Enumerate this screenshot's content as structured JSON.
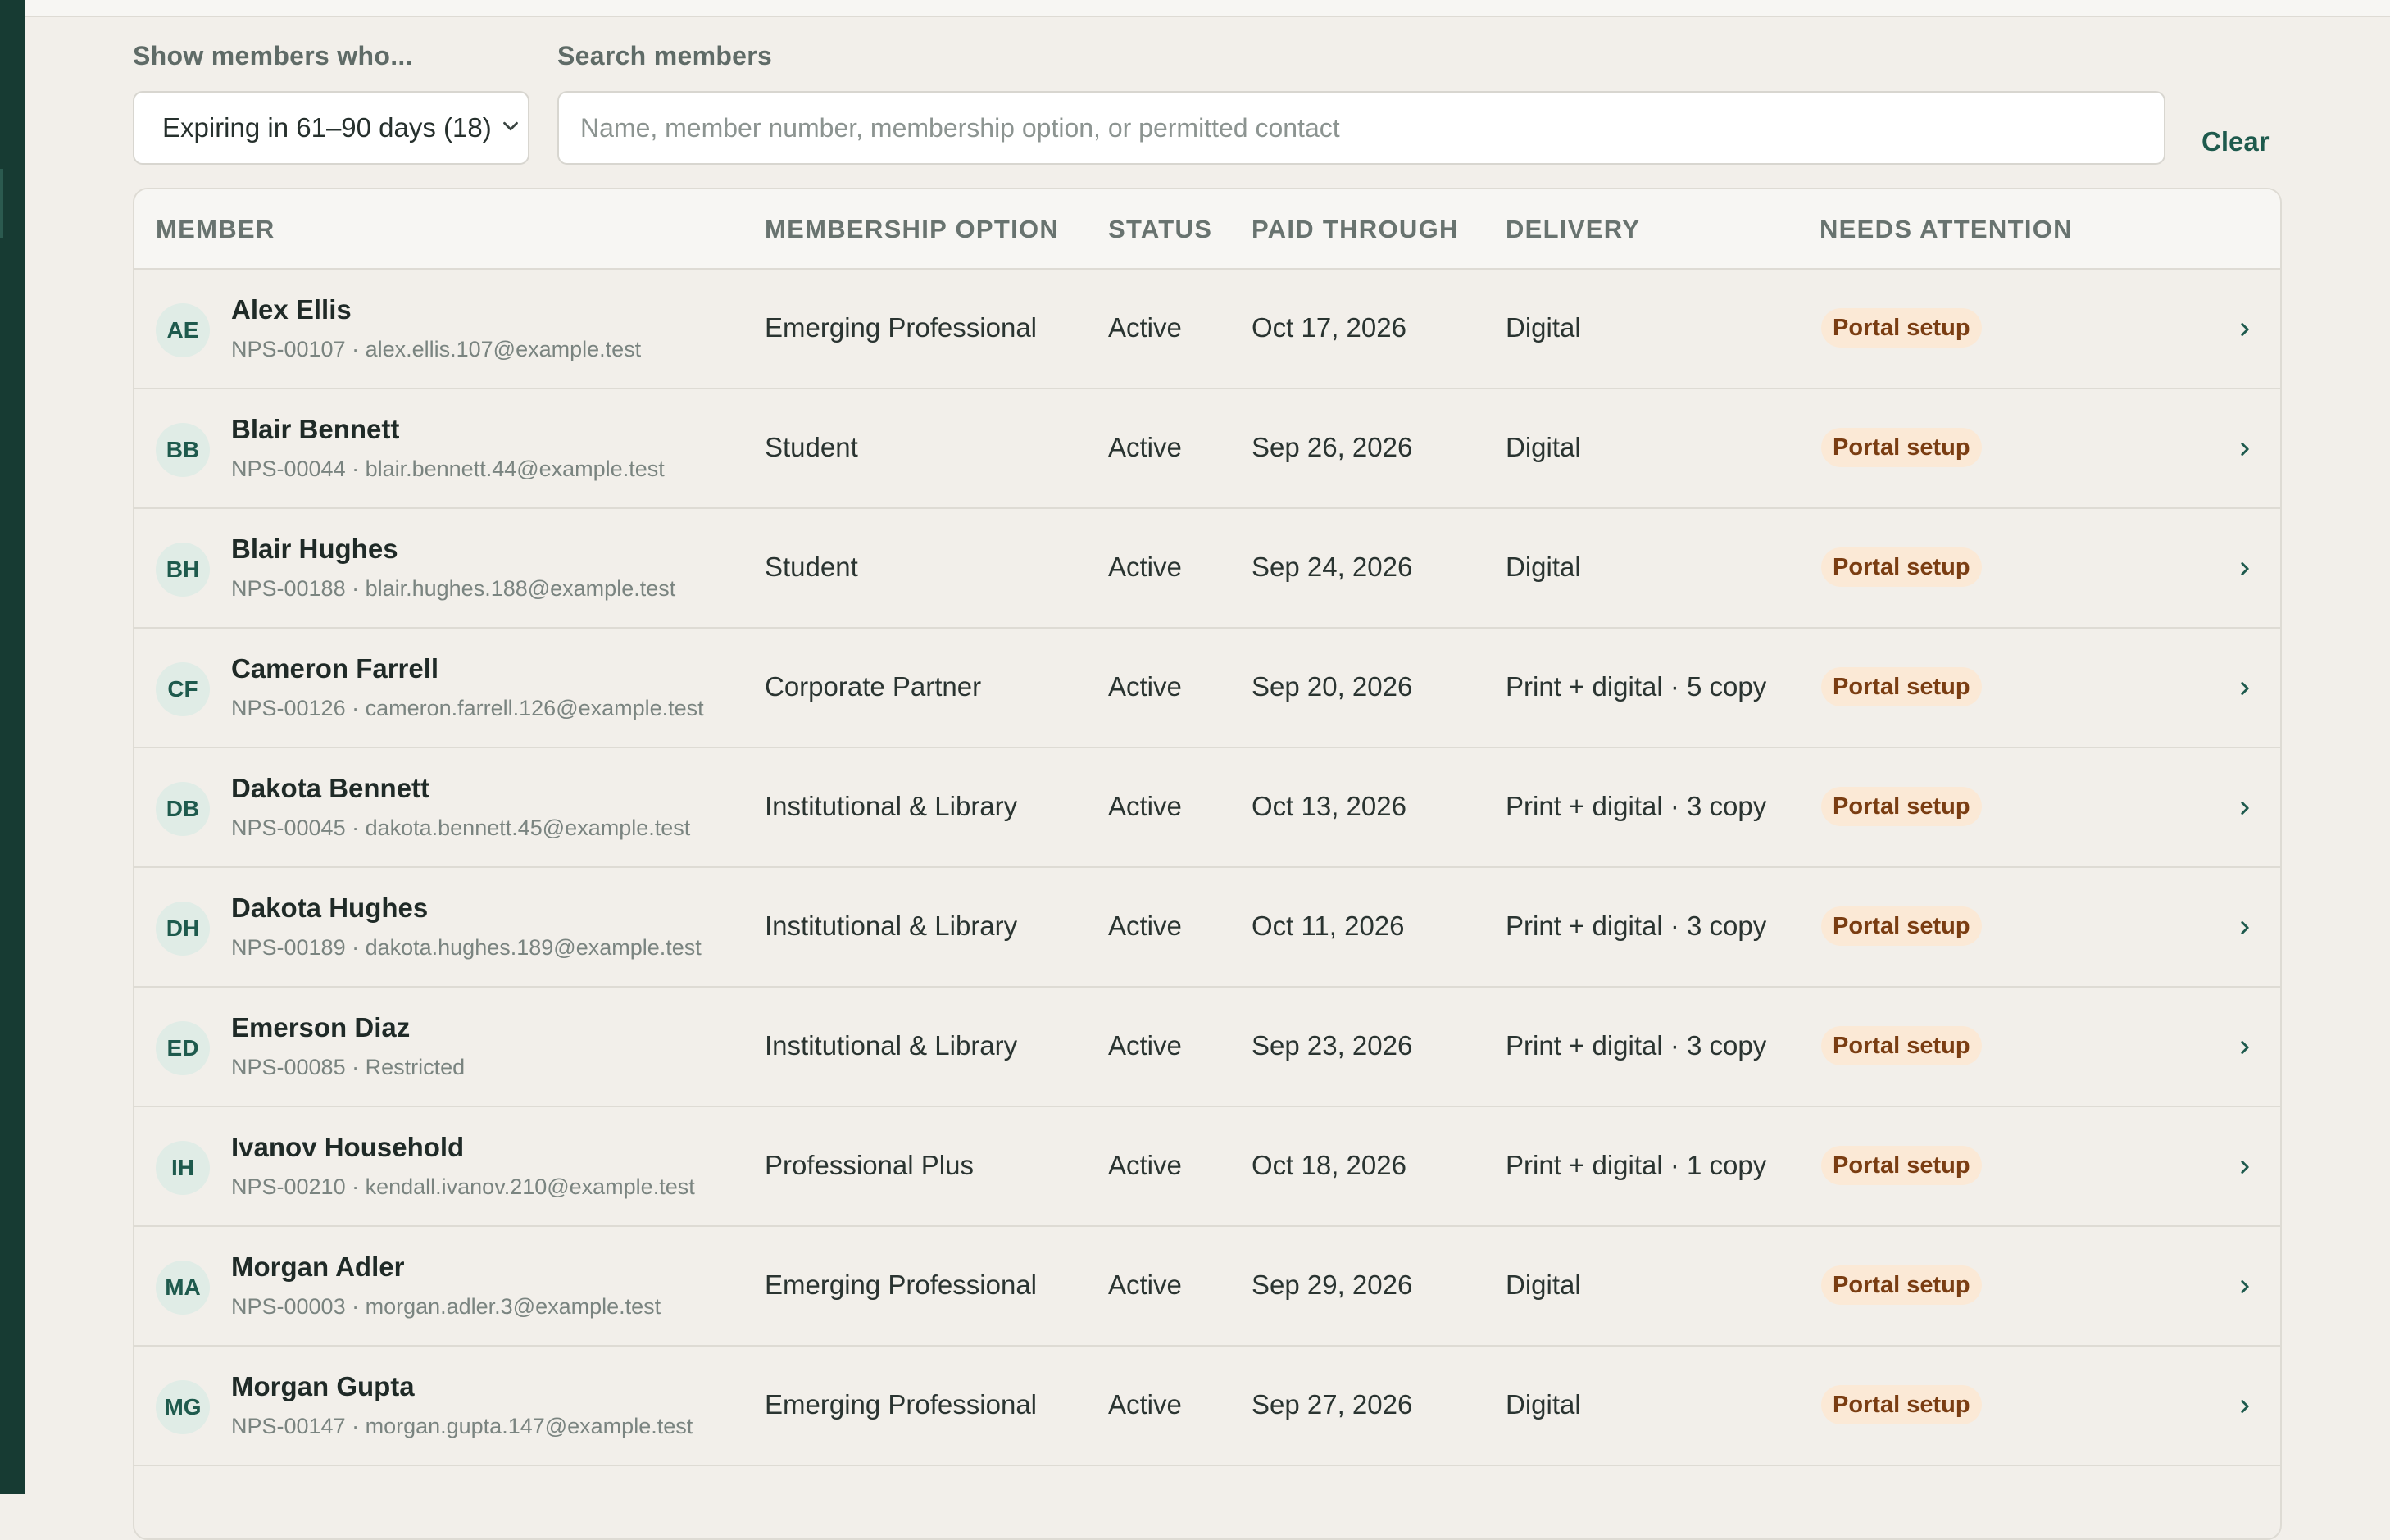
{
  "filters": {
    "show_label": "Show members who...",
    "show_value": "Expiring in 61–90 days (18)",
    "search_label": "Search members",
    "search_placeholder": "Name, member number, membership option, or permitted contact",
    "clear_label": "Clear"
  },
  "table": {
    "headers": {
      "member": "MEMBER",
      "option": "MEMBERSHIP OPTION",
      "status": "STATUS",
      "paid": "PAID THROUGH",
      "delivery": "DELIVERY",
      "attention": "NEEDS ATTENTION"
    },
    "rows": [
      {
        "initials": "AE",
        "name": "Alex Ellis",
        "sub": "NPS-00107 · alex.ellis.107@example.test",
        "option": "Emerging Professional",
        "status": "Active",
        "paid": "Oct 17, 2026",
        "delivery": "Digital",
        "attention": "Portal setup"
      },
      {
        "initials": "BB",
        "name": "Blair Bennett",
        "sub": "NPS-00044 · blair.bennett.44@example.test",
        "option": "Student",
        "status": "Active",
        "paid": "Sep 26, 2026",
        "delivery": "Digital",
        "attention": "Portal setup"
      },
      {
        "initials": "BH",
        "name": "Blair Hughes",
        "sub": "NPS-00188 · blair.hughes.188@example.test",
        "option": "Student",
        "status": "Active",
        "paid": "Sep 24, 2026",
        "delivery": "Digital",
        "attention": "Portal setup"
      },
      {
        "initials": "CF",
        "name": "Cameron Farrell",
        "sub": "NPS-00126 · cameron.farrell.126@example.test",
        "option": "Corporate Partner",
        "status": "Active",
        "paid": "Sep 20, 2026",
        "delivery": "Print + digital · 5 copy",
        "attention": "Portal setup"
      },
      {
        "initials": "DB",
        "name": "Dakota Bennett",
        "sub": "NPS-00045 · dakota.bennett.45@example.test",
        "option": "Institutional & Library",
        "status": "Active",
        "paid": "Oct 13, 2026",
        "delivery": "Print + digital · 3 copy",
        "attention": "Portal setup"
      },
      {
        "initials": "DH",
        "name": "Dakota Hughes",
        "sub": "NPS-00189 · dakota.hughes.189@example.test",
        "option": "Institutional & Library",
        "status": "Active",
        "paid": "Oct 11, 2026",
        "delivery": "Print + digital · 3 copy",
        "attention": "Portal setup"
      },
      {
        "initials": "ED",
        "name": "Emerson Diaz",
        "sub": "NPS-00085 · Restricted",
        "option": "Institutional & Library",
        "status": "Active",
        "paid": "Sep 23, 2026",
        "delivery": "Print + digital · 3 copy",
        "attention": "Portal setup"
      },
      {
        "initials": "IH",
        "name": "Ivanov Household",
        "sub": "NPS-00210 · kendall.ivanov.210@example.test",
        "option": "Professional Plus",
        "status": "Active",
        "paid": "Oct 18, 2026",
        "delivery": "Print + digital · 1 copy",
        "attention": "Portal setup"
      },
      {
        "initials": "MA",
        "name": "Morgan Adler",
        "sub": "NPS-00003 · morgan.adler.3@example.test",
        "option": "Emerging Professional",
        "status": "Active",
        "paid": "Sep 29, 2026",
        "delivery": "Digital",
        "attention": "Portal setup"
      },
      {
        "initials": "MG",
        "name": "Morgan Gupta",
        "sub": "NPS-00147 · morgan.gupta.147@example.test",
        "option": "Emerging Professional",
        "status": "Active",
        "paid": "Sep 27, 2026",
        "delivery": "Digital",
        "attention": "Portal setup"
      }
    ]
  },
  "icons": {
    "select": "chevron-down-icon",
    "row": "chevron-right-icon"
  },
  "colors": {
    "sidebar": "#173b33",
    "accent": "#1e5a4d",
    "badge_bg": "#fbe9d6",
    "badge_text": "#7a3d12",
    "background": "#f2efea"
  }
}
